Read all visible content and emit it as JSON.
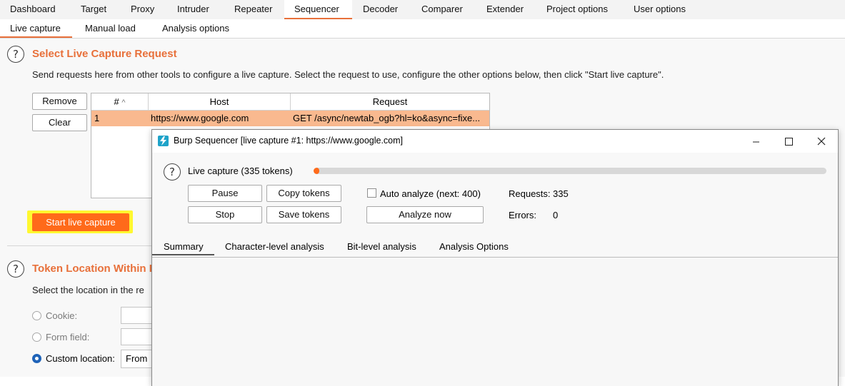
{
  "top_tabs": [
    "Dashboard",
    "Target",
    "Proxy",
    "Intruder",
    "Repeater",
    "Sequencer",
    "Decoder",
    "Comparer",
    "Extender",
    "Project options",
    "User options"
  ],
  "active_top_tab": "Sequencer",
  "sub_tabs": [
    "Live capture",
    "Manual load",
    "Analysis options"
  ],
  "active_sub_tab": "Live capture",
  "section1": {
    "title": "Select Live Capture Request",
    "description": "Send requests here from other tools to configure a live capture. Select the request to use, configure the other options below, then click \"Start live capture\".",
    "remove_label": "Remove",
    "clear_label": "Clear",
    "start_label": "Start live capture"
  },
  "request_table": {
    "headers": [
      "#",
      "Host",
      "Request"
    ],
    "sort_indicator": "^",
    "rows": [
      {
        "num": "1",
        "host": "https://www.google.com",
        "request": "GET /async/newtab_ogb?hl=ko&async=fixe..."
      }
    ]
  },
  "section2": {
    "title": "Token Location Within I",
    "description": "Select the location in the re",
    "cookie_label": "Cookie:",
    "form_field_label": "Form field:",
    "custom_location_label": "Custom location:",
    "custom_location_value": "From",
    "selected_option": "custom_location"
  },
  "sequencer_window": {
    "title": "Burp Sequencer [live capture #1: https://www.google.com]",
    "status_label": "Live capture (335 tokens)",
    "progress_fraction": 0.01,
    "pause_label": "Pause",
    "copy_tokens_label": "Copy tokens",
    "stop_label": "Stop",
    "save_tokens_label": "Save tokens",
    "auto_analyze_label": "Auto analyze (next: 400)",
    "auto_analyze_checked": false,
    "analyze_now_label": "Analyze now",
    "requests_label": "Requests:",
    "requests_value": "335",
    "errors_label": "Errors:",
    "errors_value": "0",
    "tabs": [
      "Summary",
      "Character-level analysis",
      "Bit-level analysis",
      "Analysis Options"
    ],
    "active_tab": "Summary"
  },
  "colors": {
    "accent": "#e8703a",
    "primary_button": "#ff6a1a",
    "highlight": "#fff830",
    "selected_row": "#f9b98f",
    "radio_checked": "#1f63b8",
    "app_icon": "#1fa3c9"
  },
  "icons": {
    "help": "help-icon",
    "app": "burp-lightning-icon",
    "minimize": "minimize-icon",
    "maximize": "maximize-icon",
    "close": "close-icon"
  }
}
